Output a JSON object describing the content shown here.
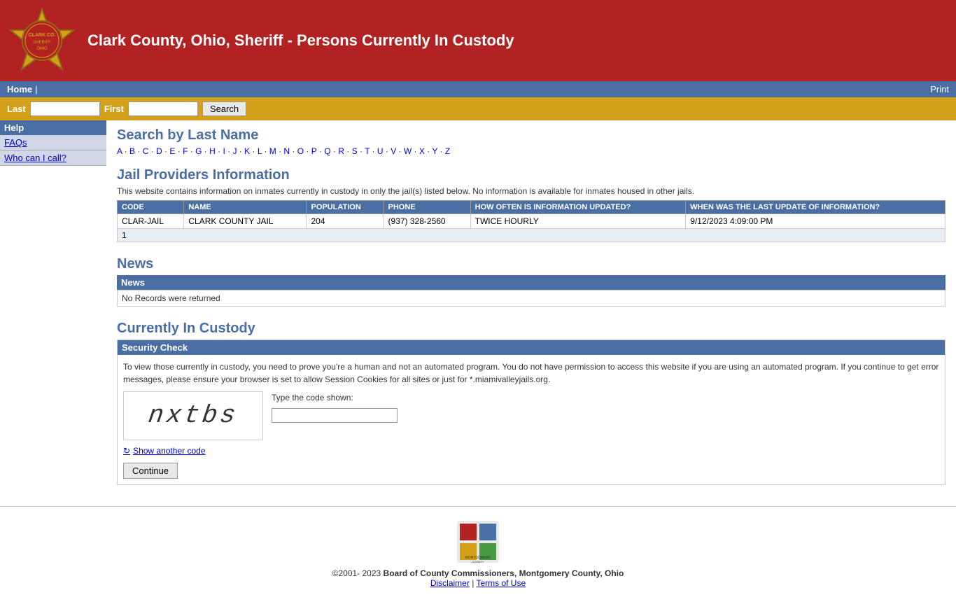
{
  "header": {
    "title": "Clark County, Ohio, Sheriff - Persons Currently In Custody",
    "logo_alt": "Clark County Sheriff Badge"
  },
  "navbar": {
    "home_label": "Home",
    "separator": "|",
    "print_label": "Print"
  },
  "searchbar": {
    "last_label": "Last",
    "first_label": "First",
    "last_value": "",
    "first_value": "",
    "button_label": "Search"
  },
  "sidebar": {
    "help_label": "Help",
    "links": [
      {
        "label": "FAQs"
      },
      {
        "label": "Who can I call?"
      }
    ]
  },
  "search_by_last_name": {
    "title": "Search by Last Name",
    "alphabet": [
      "A",
      "B",
      "C",
      "D",
      "E",
      "F",
      "G",
      "H",
      "I",
      "J",
      "K",
      "L",
      "M",
      "N",
      "O",
      "P",
      "Q",
      "R",
      "S",
      "T",
      "U",
      "V",
      "W",
      "X",
      "Y",
      "Z"
    ]
  },
  "jail_providers": {
    "title": "Jail Providers Information",
    "description": "This website contains information on inmates currently in custody in only the jail(s) listed below. No information is available for inmates housed in other jails.",
    "columns": [
      "CODE",
      "NAME",
      "POPULATION",
      "PHONE",
      "HOW OFTEN IS INFORMATION UPDATED?",
      "WHEN WAS THE LAST UPDATE OF INFORMATION?"
    ],
    "rows": [
      {
        "code": "CLAR-JAIL",
        "name": "CLARK COUNTY JAIL",
        "population": "204",
        "phone": "(937) 328-2560",
        "update_freq": "TWICE HOURLY",
        "last_update": "9/12/2023 4:09:00 PM"
      }
    ],
    "footer": "1"
  },
  "news": {
    "title": "News",
    "table_header": "News",
    "no_records": "No Records were returned"
  },
  "custody": {
    "title": "Currently In Custody",
    "security_check_header": "Security Check",
    "security_message": "To view those currently in custody, you need to prove you're a human and not an automated program. You do not have permission to access this website if you are using an automated program. If you continue to get error messages, please ensure your browser is set to allow Session Cookies for all sites or just for *.miamivalleyjails.org.",
    "captcha_value": "nxtbs",
    "type_code_label": "Type the code shown:",
    "show_another_label": "Show another code",
    "continue_label": "Continue"
  },
  "footer": {
    "copyright": "©2001- 2023 ",
    "org": "Board of County Commissioners, Montgomery County, Ohio",
    "disclaimer_label": "Disclaimer",
    "terms_label": "Terms of Use",
    "separator": "|"
  }
}
